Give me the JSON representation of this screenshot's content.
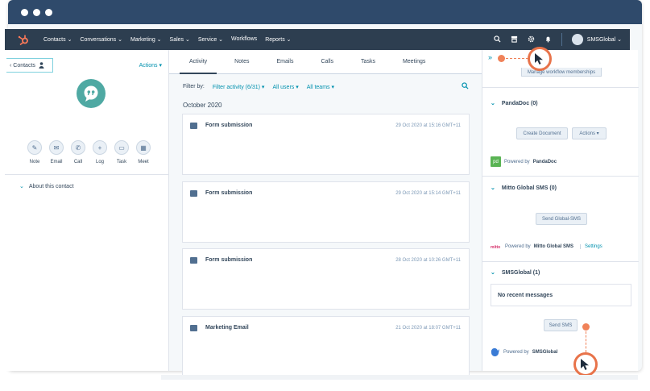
{
  "nav": {
    "items": [
      "Contacts ⌄",
      "Conversations ⌄",
      "Marketing ⌄",
      "Sales ⌄",
      "Service ⌄",
      "Workflows",
      "Reports ⌄"
    ],
    "account_label": "SMSGlobal ⌄"
  },
  "left": {
    "contacts_tab": "‹ Contacts",
    "actions_label": "Actions ▾",
    "quick_actions": [
      "Note",
      "Email",
      "Call",
      "Log",
      "Task",
      "Meet"
    ],
    "about_label": "About this contact"
  },
  "middle": {
    "tabs": [
      "Activity",
      "Notes",
      "Emails",
      "Calls",
      "Tasks",
      "Meetings"
    ],
    "filter_by": "Filter by:",
    "filter_activity": "Filter activity (6/31) ▾",
    "all_users": "All users ▾",
    "all_teams": "All teams ▾",
    "month": "October 2020",
    "cards": [
      {
        "title": "Form submission",
        "time": "29 Oct 2020 at 15:16 GMT+11"
      },
      {
        "title": "Form submission",
        "time": "29 Oct 2020 at 15:14 GMT+11"
      },
      {
        "title": "Form submission",
        "time": "28 Oct 2020 at 10:26 GMT+11"
      },
      {
        "title": "Marketing Email",
        "time": "21 Oct 2020 at 18:07 GMT+11"
      }
    ]
  },
  "right": {
    "manage_btn": "Manage workflow memberships",
    "pandadoc": {
      "header": "PandaDoc (0)",
      "create_btn": "Create Document",
      "actions_btn": "Actions ▾",
      "powered_prefix": "Powered by",
      "powered_name": "PandaDoc"
    },
    "mitto": {
      "header": "Mitto Global SMS (0)",
      "send_btn": "Send Global-SMS",
      "powered_prefix": "Powered by",
      "powered_name": "Mitto Global SMS",
      "settings_link": "Settings"
    },
    "smsglobal": {
      "header": "SMSGlobal (1)",
      "no_recent": "No recent messages",
      "send_btn": "Send SMS",
      "powered_prefix": "Powered by",
      "powered_name": "SMSGlobal"
    }
  },
  "colors": {
    "nav_bg": "#2d3e50",
    "chrome_bg": "#2f4a6b",
    "accent_link": "#0091ae",
    "callout_orange": "#e8734a"
  },
  "icons": [
    "hubspot-logo-icon",
    "search-icon",
    "marketplace-icon",
    "settings-icon",
    "notifications-icon",
    "cursor-icon"
  ]
}
